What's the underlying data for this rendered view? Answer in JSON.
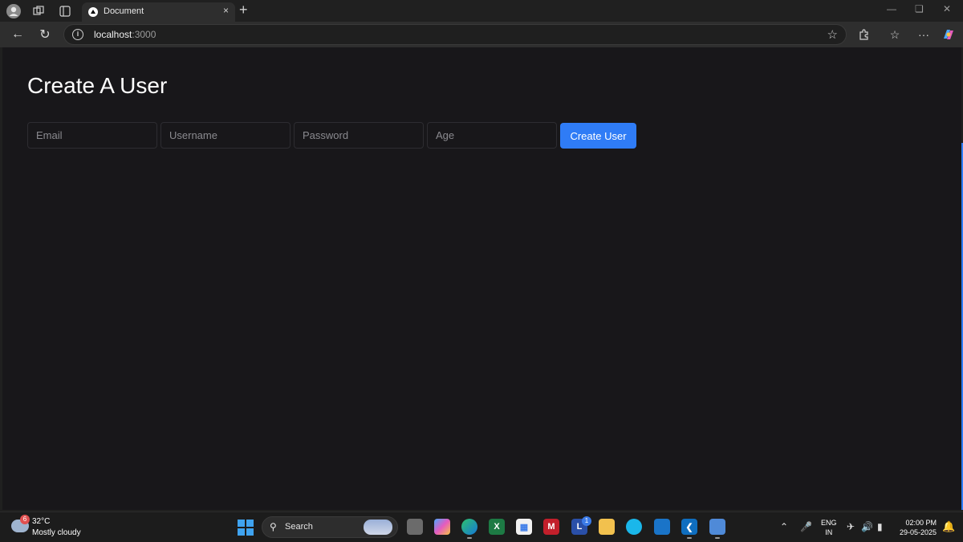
{
  "browser": {
    "tab": {
      "title": "Document",
      "close_icon": "×"
    },
    "new_tab_icon": "+",
    "address": {
      "host": "localhost",
      "port": ":3000"
    }
  },
  "page": {
    "title": "Create A User",
    "fields": {
      "email_placeholder": "Email",
      "username_placeholder": "Username",
      "password_placeholder": "Password",
      "age_placeholder": "Age"
    },
    "submit_label": "Create User",
    "accent": "#2f7cf6",
    "background": "#18171a"
  },
  "taskbar": {
    "weather": {
      "badge": "6",
      "temperature": "32°C",
      "condition": "Mostly cloudy"
    },
    "search_label": "Search",
    "store_badge": "1",
    "language": {
      "line1": "ENG",
      "line2": "IN"
    },
    "clock": {
      "time": "02:00 PM",
      "date": "29-05-2025"
    }
  }
}
